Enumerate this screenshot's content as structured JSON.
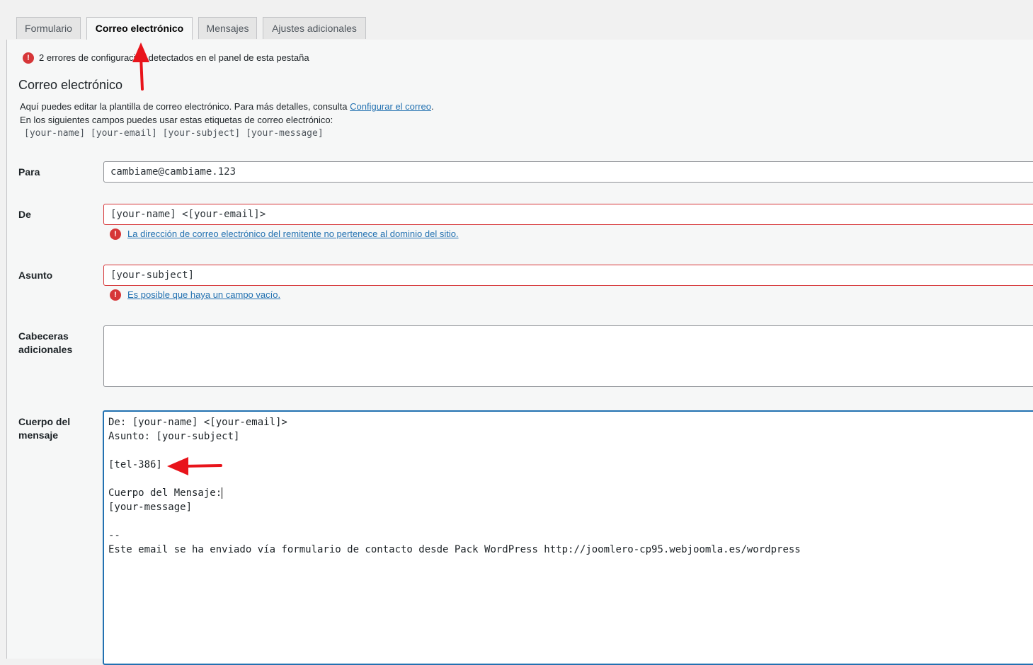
{
  "tabs": [
    {
      "label": "Formulario"
    },
    {
      "label": "Correo electrónico"
    },
    {
      "label": "Mensajes"
    },
    {
      "label": "Ajustes adicionales"
    }
  ],
  "notice": {
    "text": "2 errores de configuración detectados en el panel de esta pestaña",
    "icon": "error-icon"
  },
  "section": {
    "title": "Correo electrónico",
    "desc_prefix": "Aquí puedes editar la plantilla de correo electrónico. Para más detalles, consulta ",
    "desc_link": "Configurar el correo",
    "desc_suffix": ".",
    "desc_line2": "En los siguientes campos puedes usar estas etiquetas de correo electrónico:",
    "tags": "[your-name] [your-email] [your-subject] [your-message]"
  },
  "fields": {
    "to": {
      "label": "Para",
      "value": "cambiame@cambiame.123"
    },
    "from": {
      "label": "De",
      "value": "[your-name] <[your-email]>",
      "error": "La dirección de correo electrónico del remitente no pertenece al dominio del sitio."
    },
    "subject": {
      "label": "Asunto",
      "value": "[your-subject]",
      "error": "Es posible que haya un campo vacío."
    },
    "headers": {
      "label_line1": "Cabeceras",
      "label_line2": "adicionales",
      "value": ""
    },
    "body": {
      "label_line1": "Cuerpo del",
      "label_line2": "mensaje",
      "lines": [
        "De: [your-name] <[your-email]>",
        "Asunto: [your-subject]",
        "",
        "[tel-386]",
        "",
        "Cuerpo del Mensaje:",
        "[your-message]",
        "",
        "--",
        "Este email se ha enviado vía formulario de contacto desde Pack WordPress http://joomlero-cp95.webjoomla.es/wordpress"
      ]
    }
  },
  "colors": {
    "error": "#d63638",
    "link": "#2271b1",
    "focus": "#2271b1",
    "annotation_arrow": "#e8141b"
  }
}
